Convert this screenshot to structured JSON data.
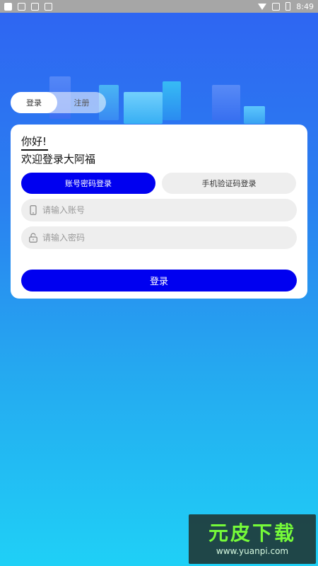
{
  "status_bar": {
    "time": "8:49"
  },
  "auth_tabs": [
    {
      "label": "登录"
    },
    {
      "label": "注册"
    }
  ],
  "card": {
    "greeting": "你好!",
    "welcome": "欢迎登录大阿福",
    "modes": [
      {
        "label": "账号密码登录"
      },
      {
        "label": "手机验证码登录"
      }
    ],
    "account_field": {
      "placeholder": "请输入账号",
      "value": ""
    },
    "password_field": {
      "placeholder": "请输入密码",
      "value": ""
    },
    "login_button": "登录"
  },
  "watermark": {
    "title": "元皮下载",
    "url": "www.yuanpi.com"
  },
  "colors": {
    "primary": "#0000f0",
    "field_bg": "#eeeeee",
    "bg_top": "#2f64f2",
    "bg_bottom": "#1fd0f6"
  }
}
